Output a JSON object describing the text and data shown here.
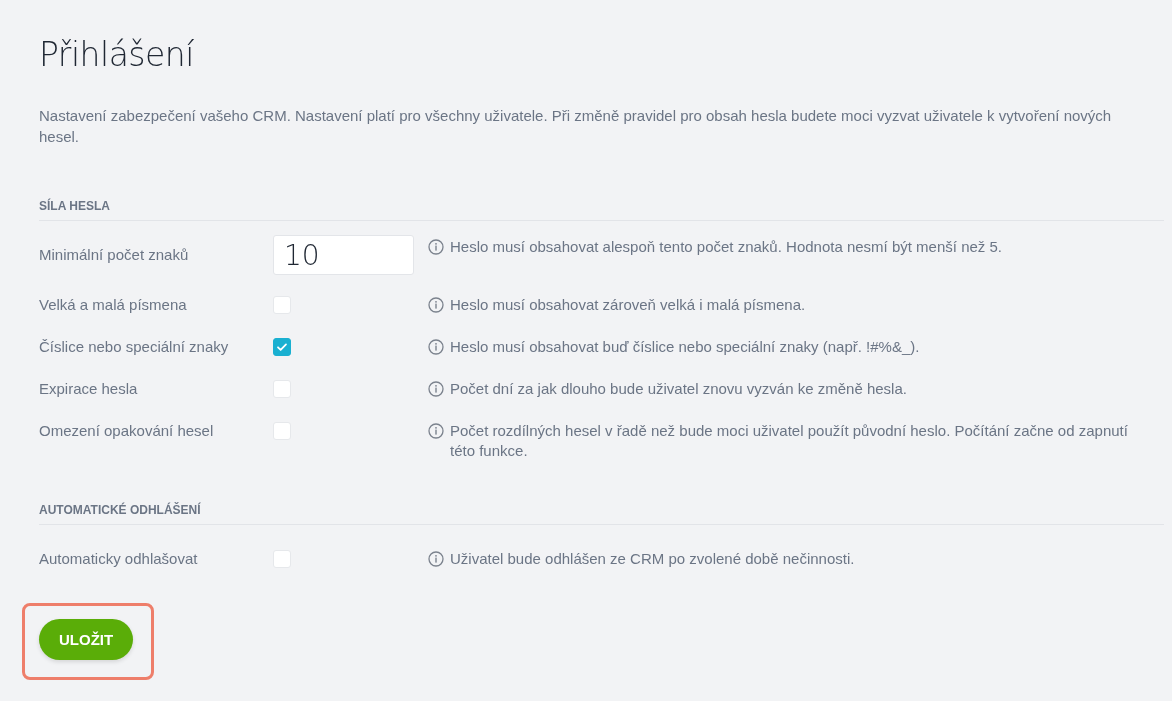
{
  "title": "Přihlášení",
  "description": "Nastavení zabezpečení vašeho CRM. Nastavení platí pro všechny uživatele. Při změně pravidel pro obsah hesla budete moci vyzvat uživatele k vytvoření nových hesel.",
  "sections": [
    {
      "heading": "SÍLA HESLA",
      "rows": [
        {
          "kind": "number",
          "label": "Minimální počet znaků",
          "value": "10",
          "hint": "Heslo musí obsahovat alespoň tento počet znaků. Hodnota nesmí být menší než 5."
        },
        {
          "kind": "checkbox",
          "label": "Velká a malá písmena",
          "checked": false,
          "hint": "Heslo musí obsahovat zároveň velká i malá písmena."
        },
        {
          "kind": "checkbox",
          "label": "Číslice nebo speciální znaky",
          "checked": true,
          "hint": "Heslo musí obsahovat buď číslice nebo speciální znaky (např. !#%&_)."
        },
        {
          "kind": "checkbox",
          "label": "Expirace hesla",
          "checked": false,
          "hint": "Počet dní za jak dlouho bude uživatel znovu vyzván ke změně hesla."
        },
        {
          "kind": "checkbox",
          "label": "Omezení opakování hesel",
          "checked": false,
          "hint": "Počet rozdílných hesel v řadě než bude moci uživatel použít původní heslo. Počítání začne od zapnutí této funkce."
        }
      ]
    },
    {
      "heading": "AUTOMATICKÉ ODHLÁŠENÍ",
      "rows": [
        {
          "kind": "checkbox",
          "label": "Automaticky odhlašovat",
          "checked": false,
          "hint": "Uživatel bude odhlášen ze CRM po zvolené době nečinnosti."
        }
      ]
    }
  ],
  "save_button": {
    "label": "ULOŽIT",
    "highlighted": true
  }
}
